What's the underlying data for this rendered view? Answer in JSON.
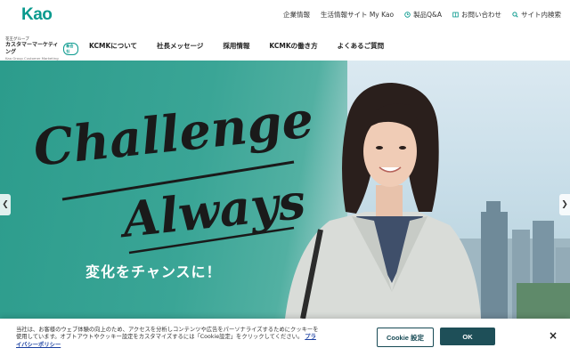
{
  "header": {
    "logo": "Kao",
    "utility_links": [
      {
        "label": "企業情報",
        "icon": ""
      },
      {
        "label": "生活情報サイト My Kao",
        "icon": ""
      },
      {
        "label": "製品Q&A",
        "icon": "clock-icon"
      },
      {
        "label": "お問い合わせ",
        "icon": "book-icon"
      },
      {
        "label": "サイト内検索",
        "icon": "search-icon"
      }
    ]
  },
  "brand": {
    "group": "花王グループ",
    "name": "カスタマーマーケティング",
    "tag": "新会社",
    "sub": "Kao Group Customer Marketing"
  },
  "nav": {
    "items": [
      "KCMKについて",
      "社長メッセージ",
      "採用情報",
      "KCMKの働き方",
      "よくあるご質問"
    ]
  },
  "hero": {
    "headline_line1": "Challenge,",
    "headline_line2": "Always",
    "tagline": "変化をチャンスに！",
    "colors": {
      "teal": "#2c9c8c",
      "logo": "#0a9a8e"
    }
  },
  "cookie": {
    "text": "当社は、お客様のウェブ体験の向上のため、アクセスを分析しコンテンツや広告をパーソナライズするためにクッキーを使用しています。オプトアウトやクッキー設定をカスタマイズするには「Cookie設定」をクリックしてください。",
    "link": "プライバシーポリシー",
    "settings_label": "Cookie 設定",
    "ok_label": "OK",
    "close_label": "×"
  }
}
